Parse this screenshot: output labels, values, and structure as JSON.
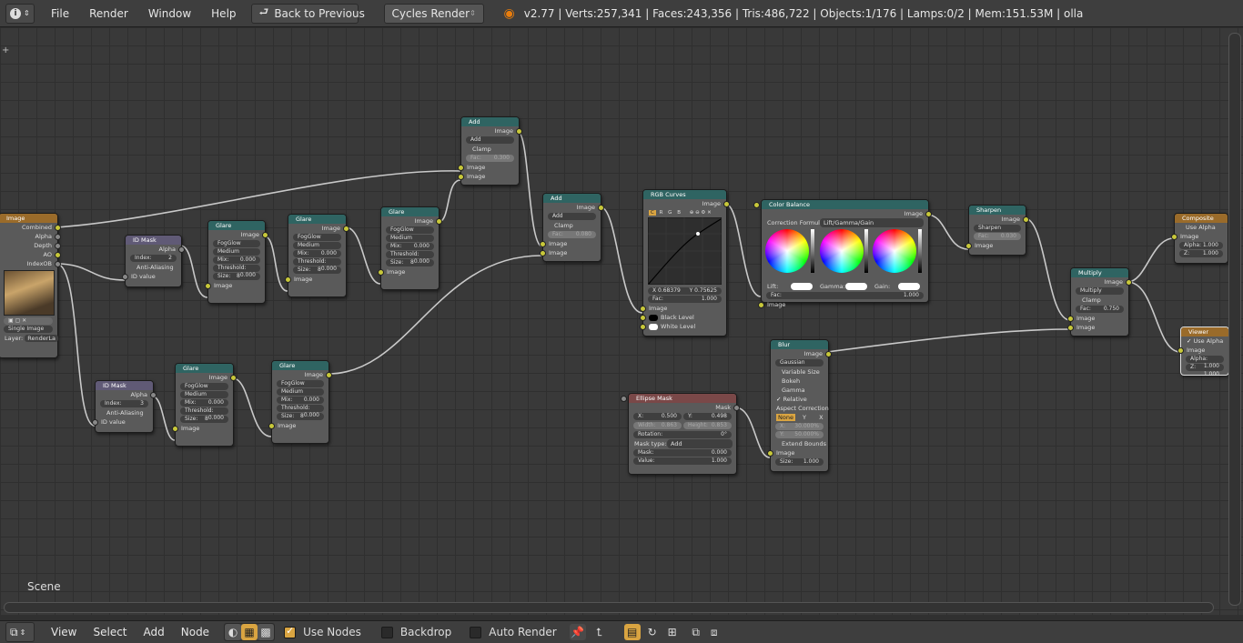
{
  "topbar": {
    "info_icon": "info-icon",
    "menus": [
      "File",
      "Render",
      "Window",
      "Help"
    ],
    "back_button": "Back to Previous",
    "render_engine": "Cycles Render",
    "stats": "v2.77 | Verts:257,341 | Faces:243,356 | Tris:486,722 | Objects:1/176 | Lamps:0/2 | Mem:151.53M | olla"
  },
  "editor": {
    "scene_label": "Scene"
  },
  "nodes": {
    "image": {
      "title": "Image",
      "outputs": [
        "Combined",
        "Alpha",
        "Depth",
        "AO",
        "IndexOB"
      ],
      "source": "Single Image",
      "layer_label": "Layer:",
      "layer": "RenderLa"
    },
    "idmask1": {
      "title": "ID Mask",
      "out": "Alpha",
      "index_label": "Index:",
      "index": "2",
      "anti": "Anti-Aliasing",
      "in": "ID value"
    },
    "idmask2": {
      "title": "ID Mask",
      "out": "Alpha",
      "index_label": "Index:",
      "index": "3",
      "anti": "Anti-Aliasing",
      "in": "ID value"
    },
    "glare1": {
      "title": "Glare",
      "out": "Image",
      "type": "FogGlow",
      "quality": "Medium",
      "mix": "Mix:",
      "mix_v": "0.000",
      "thr": "Threshold:",
      "thr_v": "0.000",
      "size": "Size:",
      "size_v": "8",
      "in": "Image"
    },
    "glare2": {
      "title": "Glare",
      "out": "Image",
      "type": "FogGlow",
      "quality": "Medium",
      "mix": "Mix:",
      "mix_v": "0.000",
      "thr": "Threshold:",
      "thr_v": "0.000",
      "size": "Size:",
      "size_v": "8",
      "in": "Image"
    },
    "glare3": {
      "title": "Glare",
      "out": "Image",
      "type": "FogGlow",
      "quality": "Medium",
      "mix": "Mix:",
      "mix_v": "0.000",
      "thr": "Threshold:",
      "thr_v": "0.000",
      "size": "Size:",
      "size_v": "8",
      "in": "Image"
    },
    "glare4": {
      "title": "Glare",
      "out": "Image",
      "type": "FogGlow",
      "quality": "Medium",
      "mix": "Mix:",
      "mix_v": "0.000",
      "thr": "Threshold:",
      "thr_v": "0.000",
      "size": "Size:",
      "size_v": "8",
      "in": "Image"
    },
    "glare5": {
      "title": "Glare",
      "out": "Image",
      "type": "FogGlow",
      "quality": "Medium",
      "mix": "Mix:",
      "mix_v": "0.000",
      "thr": "Threshold:",
      "thr_v": "0.000",
      "size": "Size:",
      "size_v": "8",
      "in": "Image"
    },
    "add1": {
      "title": "Add",
      "out": "Image",
      "blend": "Add",
      "clamp": "Clamp",
      "fac": "Fac:",
      "fac_v": "0.300",
      "in1": "Image",
      "in2": "Image"
    },
    "add2": {
      "title": "Add",
      "out": "Image",
      "blend": "Add",
      "clamp": "Clamp",
      "fac": "Fac:",
      "fac_v": "0.080",
      "in1": "Image",
      "in2": "Image"
    },
    "curves": {
      "title": "RGB Curves",
      "out": "Image",
      "x": "X 0.68379",
      "y": "Y 0.75625",
      "fac": "Fac:",
      "fac_v": "1.000",
      "in1": "Image",
      "black": "Black Level",
      "white": "White Level",
      "chans": [
        "C",
        "R",
        "G",
        "B"
      ]
    },
    "colorbal": {
      "title": "Color Balance",
      "out": "Image",
      "formula_label": "Correction Formula:",
      "formula": "Lift/Gamma/Gain",
      "lift": "Lift:",
      "gamma": "Gamma:",
      "gain": "Gain:",
      "fac": "Fac:",
      "fac_v": "1.000",
      "in": "Image"
    },
    "sharpen": {
      "title": "Sharpen",
      "out": "Image",
      "type": "Sharpen",
      "fac": "Fac:",
      "fac_v": "0.030",
      "in": "Image"
    },
    "multiply": {
      "title": "Multiply",
      "out": "Image",
      "blend": "Multiply",
      "clamp": "Clamp",
      "fac": "Fac:",
      "fac_v": "0.750",
      "in1": "Image",
      "in2": "Image"
    },
    "composite": {
      "title": "Composite",
      "use_alpha": "Use Alpha",
      "in": "Image",
      "alpha": "Alpha:",
      "alpha_v": "1.000",
      "z": "Z:",
      "z_v": "1.000"
    },
    "viewer": {
      "title": "Viewer",
      "use_alpha": "Use Alpha",
      "in": "Image",
      "alpha": "Alpha:",
      "alpha_v": "1.000",
      "z": "Z:",
      "z_v": "1.000"
    },
    "blur": {
      "title": "Blur",
      "out": "Image",
      "type": "Gaussian",
      "vs": "Variable Size",
      "bokeh": "Bokeh",
      "gamma": "Gamma",
      "relative": "Relative",
      "aspect": "Aspect Correction",
      "axes": [
        "None",
        "Y",
        "X"
      ],
      "x": "X:",
      "x_v": "30.000%",
      "y": "Y:",
      "y_v": "50.000%",
      "extend": "Extend Bounds",
      "in": "Image",
      "size": "Size:",
      "size_v": "1.000"
    },
    "ellipse": {
      "title": "Ellipse Mask",
      "out": "Mask",
      "x": "X:",
      "x_v": "0.500",
      "y": "Y:",
      "y_v": "0.498",
      "w": "Width:",
      "w_v": "0.863",
      "h": "Height:",
      "h_v": "0.853",
      "rot": "Rotation:",
      "rot_v": "0°",
      "type_label": "Mask type:",
      "type": "Add",
      "mask": "Mask:",
      "mask_v": "0.000",
      "value": "Value:",
      "value_v": "1.000"
    }
  },
  "bottombar": {
    "menus": [
      "View",
      "Select",
      "Add",
      "Node"
    ],
    "use_nodes": "Use Nodes",
    "backdrop": "Backdrop",
    "auto_render": "Auto Render"
  }
}
